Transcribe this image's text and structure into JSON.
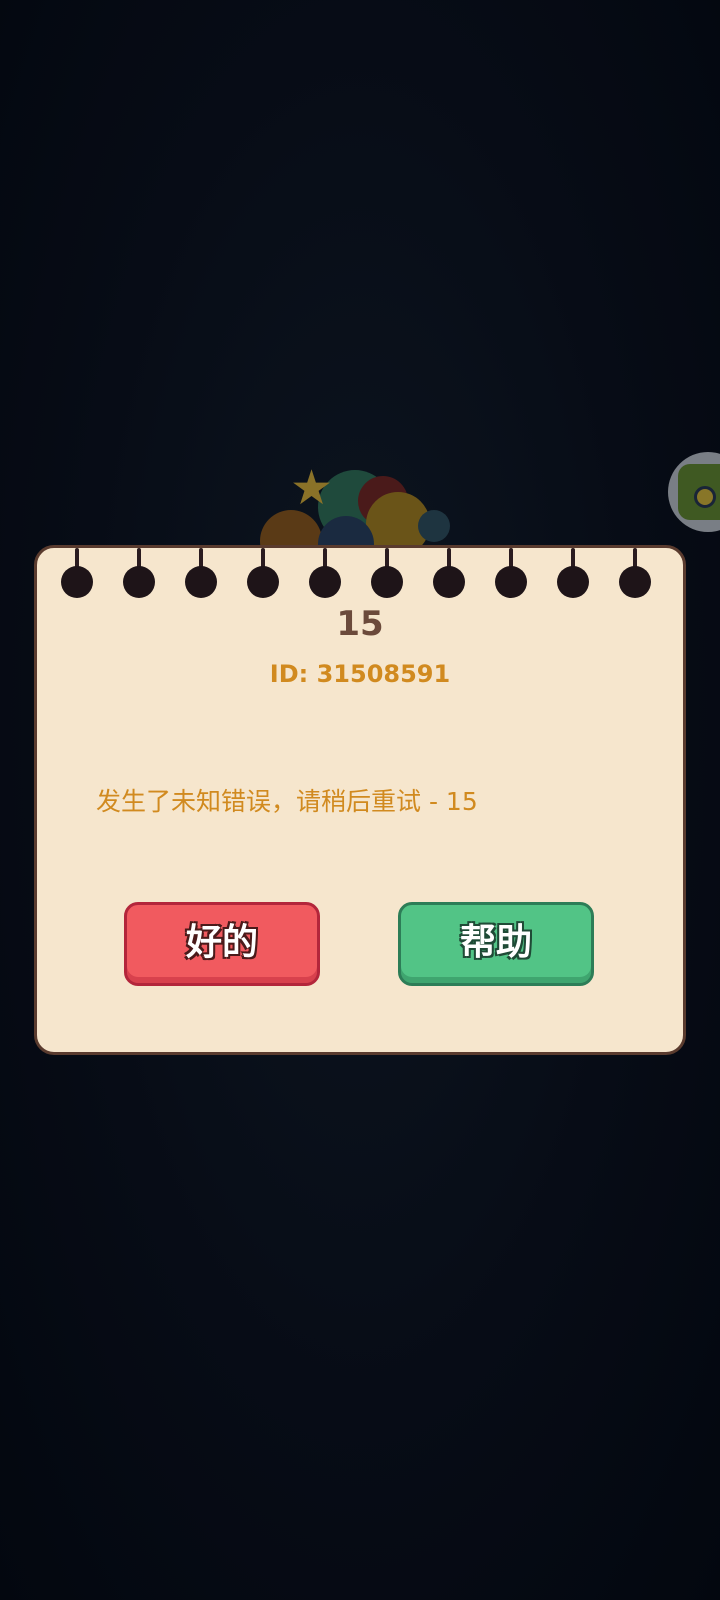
{
  "dialog": {
    "title": "15",
    "id_text": "ID: 31508591",
    "message": "发生了未知错误，请稍后重试 - 15"
  },
  "buttons": {
    "ok_label": "好的",
    "help_label": "帮助"
  },
  "icons": {
    "side_button": "game-app-icon",
    "decoration": "colored-balls-with-star"
  },
  "colors": {
    "notepad": "#f6e6cd",
    "title": "#6b4a3b",
    "accent_text": "#d18a1f",
    "ok_button": "#f15a5f",
    "help_button": "#52c486"
  }
}
